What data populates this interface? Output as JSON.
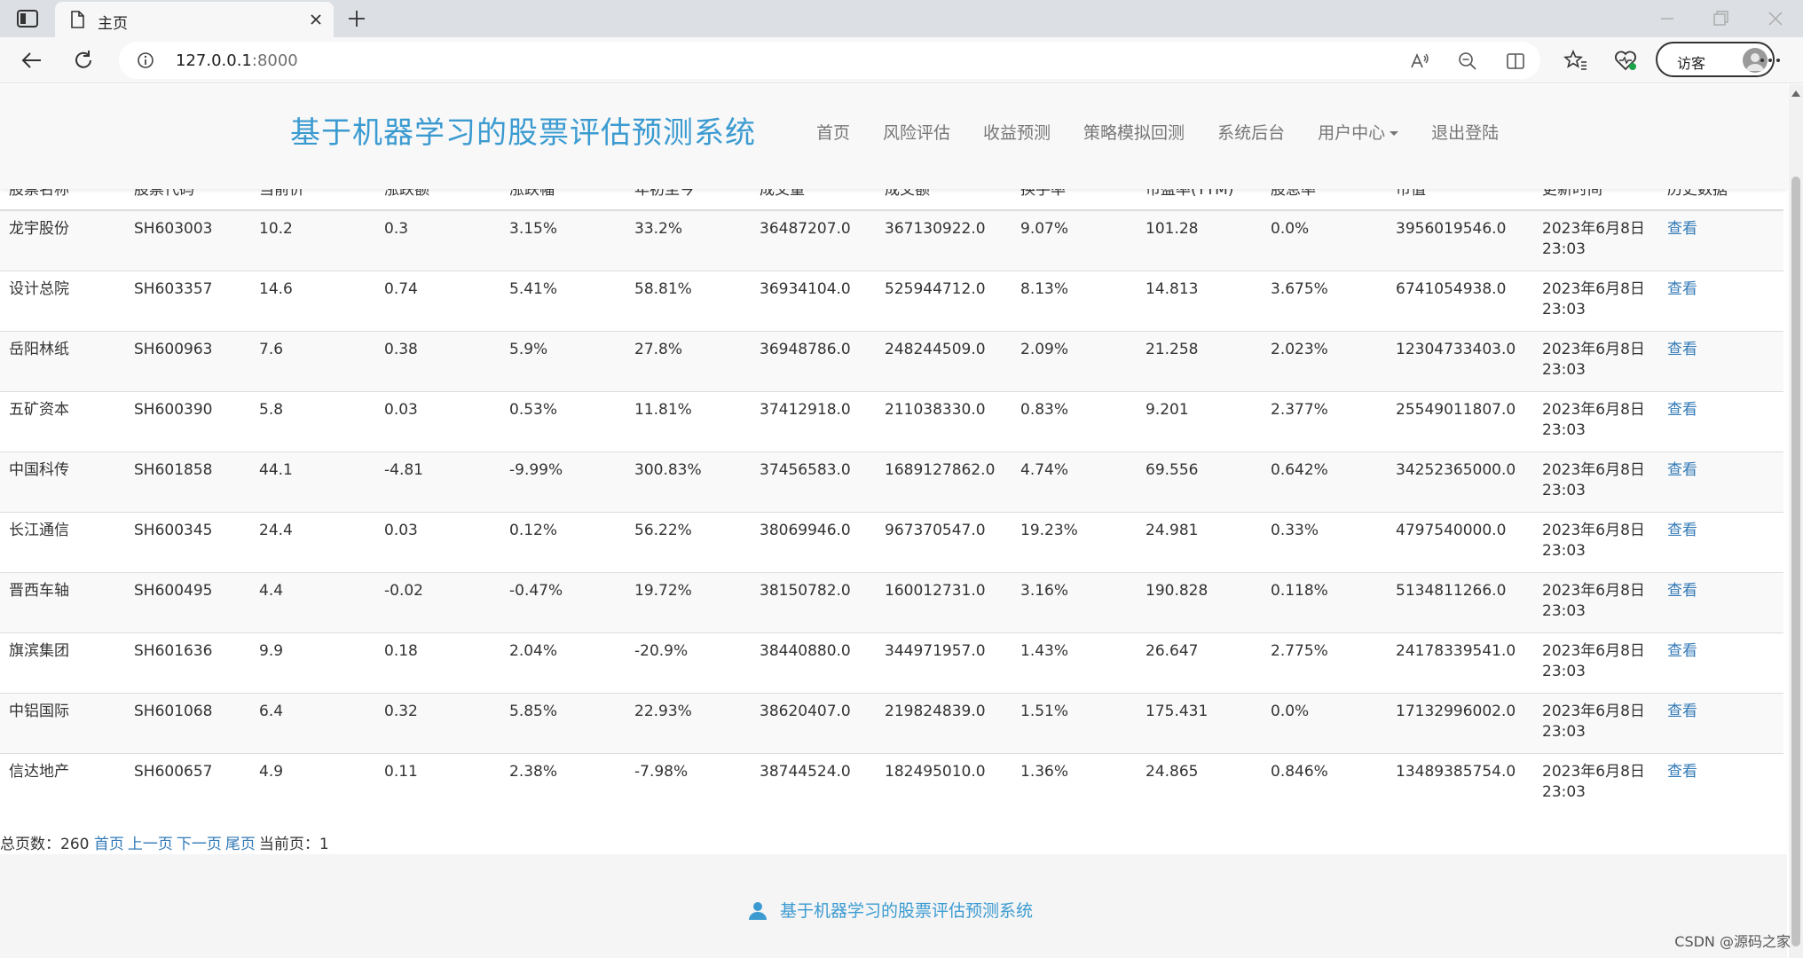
{
  "browser": {
    "tab_title": "主页",
    "url_host": "127.0.0.1",
    "url_port": ":8000",
    "profile_label": "访客"
  },
  "header": {
    "brand": "基于机器学习的股票评估预测系统",
    "nav": [
      "首页",
      "风险评估",
      "收益预测",
      "策略模拟回测",
      "系统后台",
      "用户中心",
      "退出登陆"
    ]
  },
  "table": {
    "columns": [
      "股票名称",
      "股票代码",
      "当前价",
      "涨跌额",
      "涨跌幅",
      "年初至今",
      "成交量",
      "成交额",
      "换手率",
      "市盈率(TTM)",
      "股息率",
      "市值",
      "更新时间",
      "历史数据"
    ],
    "rows": [
      [
        "龙宇股份",
        "SH603003",
        "10.2",
        "0.3",
        "3.15%",
        "33.2%",
        "36487207.0",
        "367130922.0",
        "9.07%",
        "101.28",
        "0.0%",
        "3956019546.0",
        "2023年6月8日 23:03",
        "查看"
      ],
      [
        "设计总院",
        "SH603357",
        "14.6",
        "0.74",
        "5.41%",
        "58.81%",
        "36934104.0",
        "525944712.0",
        "8.13%",
        "14.813",
        "3.675%",
        "6741054938.0",
        "2023年6月8日 23:03",
        "查看"
      ],
      [
        "岳阳林纸",
        "SH600963",
        "7.6",
        "0.38",
        "5.9%",
        "27.8%",
        "36948786.0",
        "248244509.0",
        "2.09%",
        "21.258",
        "2.023%",
        "12304733403.0",
        "2023年6月8日 23:03",
        "查看"
      ],
      [
        "五矿资本",
        "SH600390",
        "5.8",
        "0.03",
        "0.53%",
        "11.81%",
        "37412918.0",
        "211038330.0",
        "0.83%",
        "9.201",
        "2.377%",
        "25549011807.0",
        "2023年6月8日 23:03",
        "查看"
      ],
      [
        "中国科传",
        "SH601858",
        "44.1",
        "-4.81",
        "-9.99%",
        "300.83%",
        "37456583.0",
        "1689127862.0",
        "4.74%",
        "69.556",
        "0.642%",
        "34252365000.0",
        "2023年6月8日 23:03",
        "查看"
      ],
      [
        "长江通信",
        "SH600345",
        "24.4",
        "0.03",
        "0.12%",
        "56.22%",
        "38069946.0",
        "967370547.0",
        "19.23%",
        "24.981",
        "0.33%",
        "4797540000.0",
        "2023年6月8日 23:03",
        "查看"
      ],
      [
        "晋西车轴",
        "SH600495",
        "4.4",
        "-0.02",
        "-0.47%",
        "19.72%",
        "38150782.0",
        "160012731.0",
        "3.16%",
        "190.828",
        "0.118%",
        "5134811266.0",
        "2023年6月8日 23:03",
        "查看"
      ],
      [
        "旗滨集团",
        "SH601636",
        "9.9",
        "0.18",
        "2.04%",
        "-20.9%",
        "38440880.0",
        "344971957.0",
        "1.43%",
        "26.647",
        "2.775%",
        "24178339541.0",
        "2023年6月8日 23:03",
        "查看"
      ],
      [
        "中铝国际",
        "SH601068",
        "6.4",
        "0.32",
        "5.85%",
        "22.93%",
        "38620407.0",
        "219824839.0",
        "1.51%",
        "175.431",
        "0.0%",
        "17132996002.0",
        "2023年6月8日 23:03",
        "查看"
      ],
      [
        "信达地产",
        "SH600657",
        "4.9",
        "0.11",
        "2.38%",
        "-7.98%",
        "38744524.0",
        "182495010.0",
        "1.36%",
        "24.865",
        "0.846%",
        "13489385754.0",
        "2023年6月8日 23:03",
        "查看"
      ]
    ]
  },
  "pagination": {
    "total_label": "总页数：260",
    "first": "首页",
    "prev": "上一页",
    "next": "下一页",
    "last": "尾页",
    "current_label": "当前页：1"
  },
  "footer": {
    "text": "基于机器学习的股票评估预测系统"
  },
  "watermark": "CSDN @源码之家",
  "colors": {
    "brand": "#3b9bd1",
    "link": "#337ab7",
    "nav_text": "#777777"
  }
}
